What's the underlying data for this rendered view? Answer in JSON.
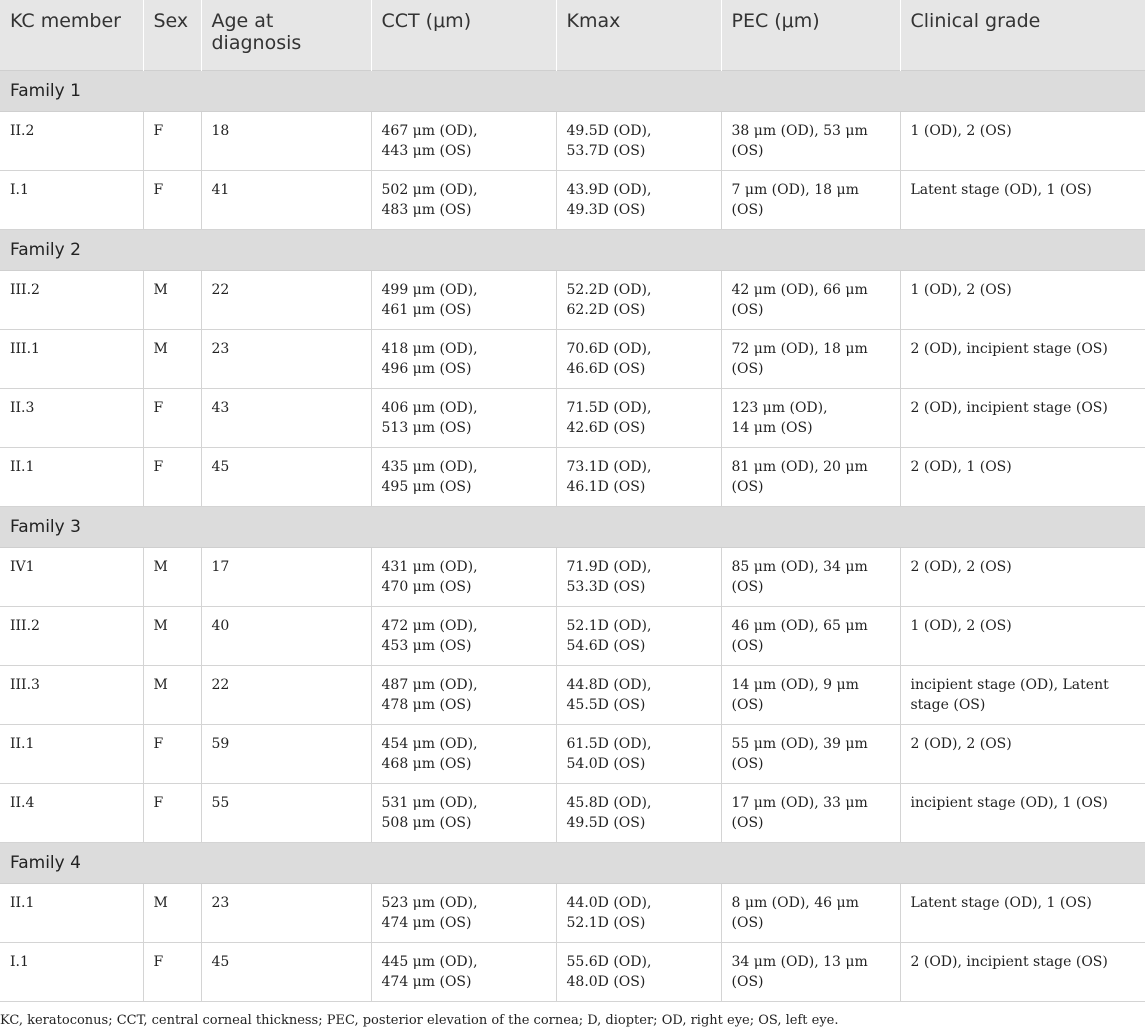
{
  "headers": [
    "KC member",
    "Sex",
    "Age at diagnosis",
    "CCT (μm)",
    "Kmax",
    "PEC (μm)",
    "Clinical grade"
  ],
  "groups": [
    {
      "label": "Family 1",
      "rows": [
        {
          "member": "II.2",
          "sex": "F",
          "age": "18",
          "cct": [
            "467 μm (OD),",
            "443 μm (OS)"
          ],
          "kmax": [
            "49.5D (OD),",
            "53.7D (OS)"
          ],
          "pec": [
            "38 μm (OD), 53 μm (OS)"
          ],
          "grade": [
            "1 (OD), 2 (OS)"
          ]
        },
        {
          "member": "I.1",
          "sex": "F",
          "age": "41",
          "cct": [
            "502 μm (OD),",
            "483 μm (OS)"
          ],
          "kmax": [
            "43.9D (OD),",
            "49.3D (OS)"
          ],
          "pec": [
            "7 μm (OD), 18 μm (OS)"
          ],
          "grade": [
            "Latent stage (OD), 1 (OS)"
          ]
        }
      ]
    },
    {
      "label": "Family 2",
      "rows": [
        {
          "member": "III.2",
          "sex": "M",
          "age": "22",
          "cct": [
            "499 μm (OD),",
            "461 μm (OS)"
          ],
          "kmax": [
            "52.2D (OD),",
            "62.2D (OS)"
          ],
          "pec": [
            "42 μm (OD), 66 μm (OS)"
          ],
          "grade": [
            "1 (OD), 2 (OS)"
          ]
        },
        {
          "member": "III.1",
          "sex": "M",
          "age": "23",
          "cct": [
            "418 μm (OD),",
            "496 μm (OS)"
          ],
          "kmax": [
            "70.6D (OD),",
            "46.6D (OS)"
          ],
          "pec": [
            "72 μm (OD), 18 μm (OS)"
          ],
          "grade": [
            "2 (OD), incipient stage (OS)"
          ]
        },
        {
          "member": "II.3",
          "sex": "F",
          "age": "43",
          "cct": [
            "406 μm (OD),",
            "513 μm (OS)"
          ],
          "kmax": [
            "71.5D (OD),",
            "42.6D (OS)"
          ],
          "pec": [
            "123 μm (OD),",
            "14 μm (OS)"
          ],
          "grade": [
            "2 (OD), incipient stage (OS)"
          ]
        },
        {
          "member": "II.1",
          "sex": "F",
          "age": "45",
          "cct": [
            "435 μm (OD),",
            "495 μm (OS)"
          ],
          "kmax": [
            "73.1D (OD),",
            "46.1D (OS)"
          ],
          "pec": [
            "81 μm (OD), 20 μm (OS)"
          ],
          "grade": [
            "2 (OD), 1 (OS)"
          ]
        }
      ]
    },
    {
      "label": "Family 3",
      "rows": [
        {
          "member": "IV1",
          "sex": "M",
          "age": "17",
          "cct": [
            "431 μm (OD),",
            "470 μm (OS)"
          ],
          "kmax": [
            "71.9D (OD),",
            "53.3D (OS)"
          ],
          "pec": [
            "85 μm (OD), 34 μm (OS)"
          ],
          "grade": [
            "2 (OD), 2 (OS)"
          ]
        },
        {
          "member": "III.2",
          "sex": "M",
          "age": "40",
          "cct": [
            "472 μm (OD),",
            "453 μm (OS)"
          ],
          "kmax": [
            "52.1D (OD),",
            "54.6D (OS)"
          ],
          "pec": [
            "46 μm (OD), 65 μm (OS)"
          ],
          "grade": [
            "1 (OD), 2 (OS)"
          ]
        },
        {
          "member": "III.3",
          "sex": "M",
          "age": "22",
          "cct": [
            "487 μm (OD),",
            "478 μm (OS)"
          ],
          "kmax": [
            "44.8D (OD),",
            "45.5D (OS)"
          ],
          "pec": [
            "14 μm (OD), 9 μm (OS)"
          ],
          "grade": [
            "incipient stage (OD), Latent",
            "stage (OS)"
          ]
        },
        {
          "member": "II.1",
          "sex": "F",
          "age": "59",
          "cct": [
            "454 μm (OD),",
            "468 μm (OS)"
          ],
          "kmax": [
            "61.5D (OD),",
            "54.0D (OS)"
          ],
          "pec": [
            "55 μm (OD), 39 μm (OS)"
          ],
          "grade": [
            "2 (OD), 2 (OS)"
          ]
        },
        {
          "member": "II.4",
          "sex": "F",
          "age": "55",
          "cct": [
            "531 μm (OD),",
            "508 μm (OS)"
          ],
          "kmax": [
            "45.8D (OD),",
            "49.5D (OS)"
          ],
          "pec": [
            "17 μm (OD), 33 μm (OS)"
          ],
          "grade": [
            "incipient stage (OD), 1 (OS)"
          ]
        }
      ]
    },
    {
      "label": "Family 4",
      "rows": [
        {
          "member": "II.1",
          "sex": "M",
          "age": "23",
          "cct": [
            "523 μm (OD),",
            "474 μm (OS)"
          ],
          "kmax": [
            "44.0D (OD),",
            "52.1D (OS)"
          ],
          "pec": [
            "8 μm (OD), 46 μm (OS)"
          ],
          "grade": [
            "Latent stage (OD), 1 (OS)"
          ]
        },
        {
          "member": "I.1",
          "sex": "F",
          "age": "45",
          "cct": [
            "445 μm (OD),",
            "474 μm (OS)"
          ],
          "kmax": [
            "55.6D (OD),",
            "48.0D (OS)"
          ],
          "pec": [
            "34 μm (OD), 13 μm (OS)"
          ],
          "grade": [
            "2 (OD), incipient stage (OS)"
          ]
        }
      ]
    }
  ],
  "footnote": "KC, keratoconus; CCT, central corneal thickness; PEC, posterior elevation of the cornea; D, diopter; OD, right eye; OS, left eye."
}
